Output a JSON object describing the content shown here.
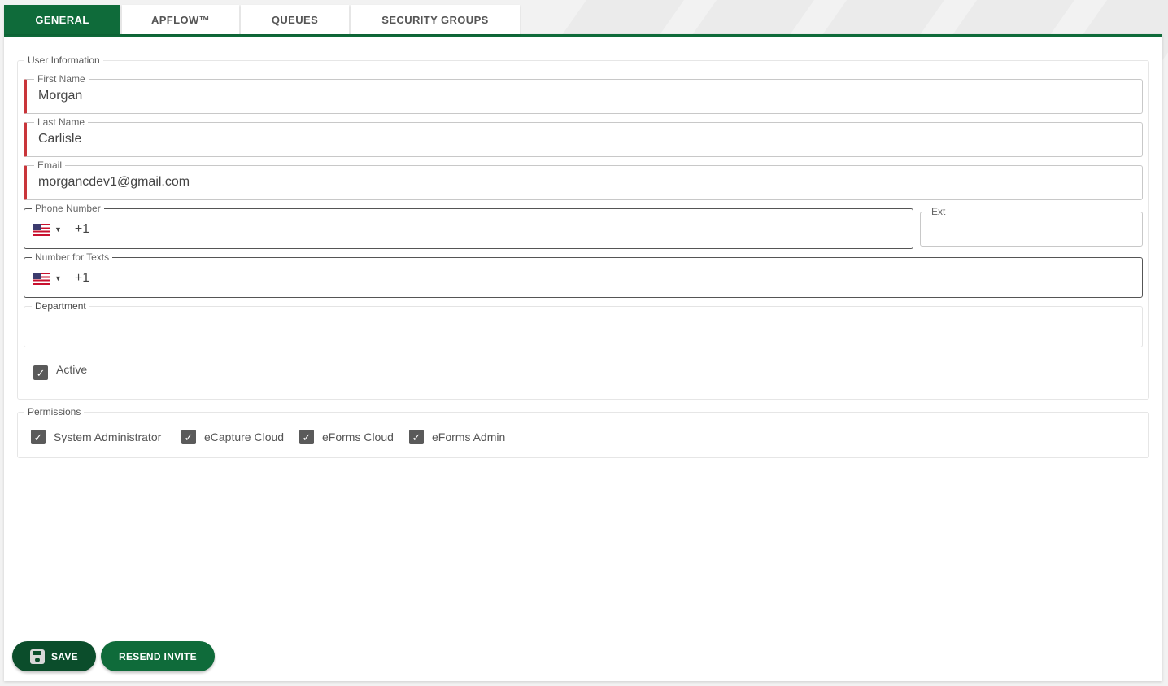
{
  "tabs": [
    {
      "label": "GENERAL",
      "active": true
    },
    {
      "label": "APFLOW™",
      "active": false
    },
    {
      "label": "QUEUES",
      "active": false
    },
    {
      "label": "SECURITY GROUPS",
      "active": false
    }
  ],
  "user_info": {
    "legend": "User Information",
    "first_name": {
      "label": "First Name",
      "value": "Morgan"
    },
    "last_name": {
      "label": "Last Name",
      "value": "Carlisle"
    },
    "email": {
      "label": "Email",
      "value": "morgancdev1@gmail.com"
    },
    "phone": {
      "label": "Phone Number",
      "dial_code": "+1",
      "country_icon": "us-flag-icon"
    },
    "ext": {
      "label": "Ext",
      "value": ""
    },
    "text_number": {
      "label": "Number for Texts",
      "dial_code": "+1",
      "country_icon": "us-flag-icon"
    },
    "department": {
      "label": "Department",
      "value": ""
    },
    "active": {
      "label": "Active",
      "checked": true
    }
  },
  "permissions": {
    "legend": "Permissions",
    "items": [
      {
        "label": "System Administrator",
        "checked": true
      },
      {
        "label": "eCapture Cloud",
        "checked": true
      },
      {
        "label": "eForms Cloud",
        "checked": true
      },
      {
        "label": "eForms Admin",
        "checked": true
      }
    ]
  },
  "actions": {
    "save_label": "SAVE",
    "resend_label": "RESEND INVITE"
  },
  "colors": {
    "accent_green": "#0f6b3a",
    "required_red": "#c9353a",
    "checkbox_gray": "#5a5a5a"
  }
}
